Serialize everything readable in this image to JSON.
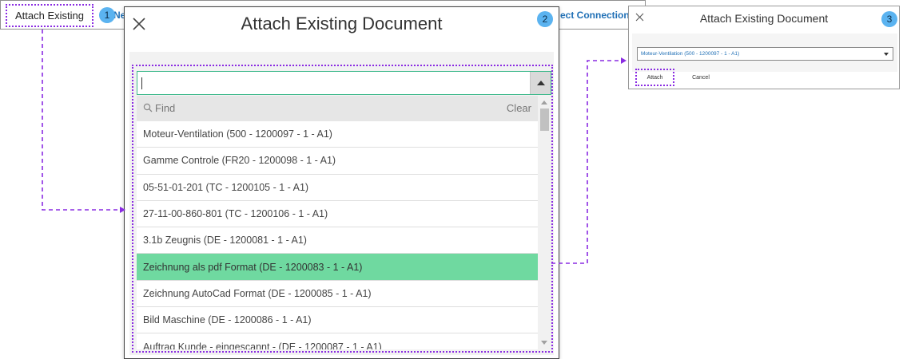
{
  "strip": {
    "attach_tab_label": "Attach Existing",
    "left_link_text": "Ne",
    "right_link_text": "ect Connections"
  },
  "steps": [
    "1",
    "2",
    "3"
  ],
  "dialog": {
    "title": "Attach Existing Document",
    "combo_value": "",
    "find_placeholder": "Find",
    "clear_label": "Clear",
    "items": [
      {
        "label": "Moteur-Ventilation (500 - 1200097 - 1 - A1)",
        "selected": false
      },
      {
        "label": "Gamme Controle (FR20 - 1200098 - 1 - A1)",
        "selected": false
      },
      {
        "label": "05-51-01-201 (TC - 1200105 - 1 - A1)",
        "selected": false
      },
      {
        "label": "27-11-00-860-801 (TC - 1200106 - 1 - A1)",
        "selected": false
      },
      {
        "label": "3.1b Zeugnis (DE - 1200081 - 1 - A1)",
        "selected": false
      },
      {
        "label": "Zeichnung als pdf Format (DE - 1200083 - 1 - A1)",
        "selected": true
      },
      {
        "label": "Zeichnung AutoCad Format (DE - 1200085 - 1 - A1)",
        "selected": false
      },
      {
        "label": "Bild Maschine (DE - 1200086 - 1 - A1)",
        "selected": false
      },
      {
        "label": "Auftrag Kunde - eingescannt - (DE - 1200087 - 1 - A1)",
        "selected": false
      }
    ]
  },
  "mini": {
    "title": "Attach Existing Document",
    "combo_value": "Moteur-Ventilation (500 - 1200097 - 1 - A1)",
    "attach_label": "Attach",
    "cancel_label": "Cancel"
  },
  "colors": {
    "accent_dotted": "#8a2be2",
    "selected_row": "#6fd9a0",
    "step_badge": "#5bb3f0",
    "link": "#1f6fb5",
    "combo_border": "#3cb88a"
  }
}
